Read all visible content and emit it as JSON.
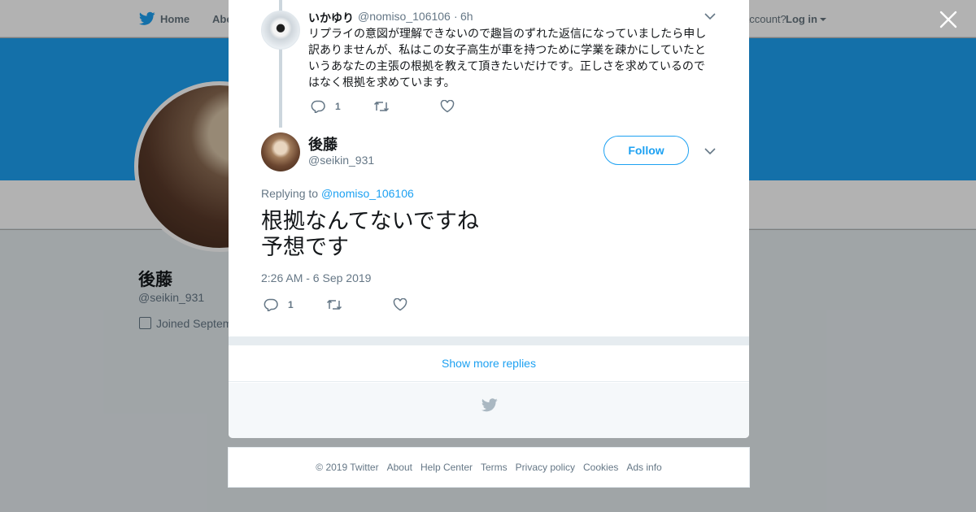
{
  "colors": {
    "brand": "#1da1f2",
    "text": "#14171a",
    "muted": "#657786"
  },
  "background": {
    "nav": {
      "home": "Home",
      "about": "Abo",
      "account_prompt": "account?",
      "login": "Log in"
    },
    "profile": {
      "name": "後藤",
      "handle": "@seikin_931",
      "joined": "Joined Septem"
    }
  },
  "modal": {
    "reply1": {
      "name": "いかゆり",
      "handle": "@nomiso_106106",
      "dot": "·",
      "time": "6h",
      "text": "リプライの意図が理解できないので趣旨のずれた返信になっていましたら申し訳ありませんが、私はこの女子高生が車を持つために学業を疎かにしていたというあなたの主張の根拠を教えて頂きたいだけです。正しさを求めているのではなく根拠を求めています。",
      "reply_count": "1"
    },
    "tweet": {
      "name": "後藤",
      "handle": "@seikin_931",
      "follow_label": "Follow",
      "replying_prefix": "Replying to",
      "replying_to": "@nomiso_106106",
      "text_line1": "根拠なんてないですね",
      "text_line2": "予想です",
      "timestamp": "2:26 AM - 6 Sep 2019",
      "reply_count": "1"
    },
    "show_more": "Show more replies"
  },
  "footer": {
    "copyright": "© 2019 Twitter",
    "links": [
      "About",
      "Help Center",
      "Terms",
      "Privacy policy",
      "Cookies",
      "Ads info"
    ]
  },
  "icons": [
    "twitter-bird-icon",
    "close-icon",
    "chevron-down-icon",
    "reply-icon",
    "retweet-icon",
    "like-icon",
    "calendar-icon"
  ]
}
